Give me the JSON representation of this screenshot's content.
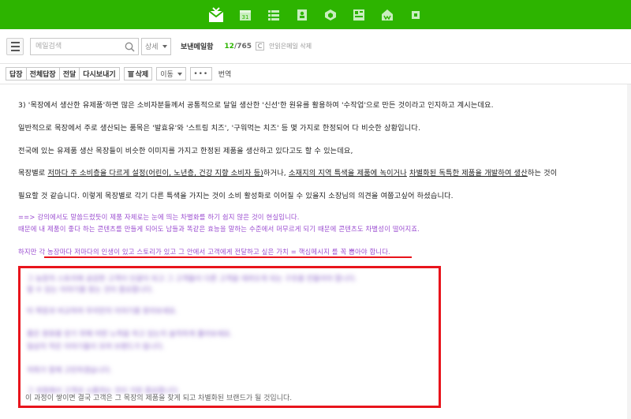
{
  "appbar": {
    "bg": "#2db400",
    "icons": [
      "mail-icon",
      "calendar-icon",
      "list-icon",
      "contacts-icon",
      "drive-icon",
      "memo-icon",
      "cafe-icon",
      "more-app-icon"
    ]
  },
  "search": {
    "placeholder": "메일검색",
    "detail_label": "상세"
  },
  "folder": {
    "title": "보낸메일함",
    "unread": "12",
    "total": "/765",
    "refresh": "C",
    "perm_delete": "안읽은메일 삭제"
  },
  "toolbar": {
    "reply": "답장",
    "reply_all": "전체답장",
    "forward": "전달",
    "resend": "다시보내기",
    "delete": "삭제",
    "move": "이동",
    "more": "•••",
    "translate": "번역"
  },
  "body": {
    "p1": "3) '목장에서 생산한 유제품'하면 많은 소비자분들께서 공통적으로 달일 생산한 '신선'한 원유를 활용하여 '수작업'으로 만든 것이라고 인지하고 계시는데요.",
    "p2": "일반적으로 목장에서 주로 생산되는 품목은 '발효유'와 '스트링 치즈', '구워먹는 치즈' 등 몇 가지로 한정되어 다 비슷한 상황입니다.",
    "p3": "전국에 있는 유제품 생산 목장들이 비슷한 이미지를 가지고 한정된 제품을 생산하고 있다고도 할 수 있는데요,",
    "p4a": "목장별로 ",
    "p4b": "저마다 주 소비층을 다르게 설정(어린이, 노년층, 건강 지향 소비자 등)",
    "p4c": "하거나, ",
    "p4d": "소재지의 지역 특색을 제품에 녹이거나",
    "p4e": " ",
    "p4f": "차별화된 독특한 제품을 개발하여 생산",
    "p4g": "하는 것이",
    "p5": "필요할 것 같습니다. 이렇게 목장별로 각기 다른 특색을 가지는 것이 소비 활성화로 이어질 수 있을지 소장님의 의견을 여쭙고싶어 하셨습니다.",
    "c1": "==> 강의에서도 말씀드렸듯이 제품 자체로는 눈에 띄는 차별화를 하기 쉽지 않은 것이 현실입니다.",
    "c2": "때문에 내 제품이 좋다 하는 콘텐츠를 만들게 되어도 남들과 똑같은 효능을 말하는 수준에서 머무르게 되기 때문에 콘텐츠도 차별성이 떨어지죠.",
    "c3": "하지만 각 농장마다 저마다의 인생이 있고 스토리가 있고 그 안에서 고객에게 전달하고 싶은 가치 = 핵심메시지 를 꼭 뽑아야 합니다.",
    "blur1": "그 농장의 스토리에 공감한 고객이 단골이 되고 그 고객들이 다른 고객을 데려오게 되는 구조를 만들어야 합니다.",
    "blur2": "할 수 있는 이야기를 찾는 것이 중요합니다.",
    "blur3": "타 목장과 비교하여 우리만의 이야기를 찾아보세요.",
    "blur4": "좋은 원유를 얻기 위해 어떤 노력을 하고 있는지 솔직하게 풀어보세요.",
    "blur5": "일상의 작은 이야기들이 모여 브랜드가 됩니다.",
    "blur6": "저희가 함께 고민하겠습니다.",
    "blur7": "그 과정에서 고객과 소통하는 것이 가장 중요합니다.",
    "last": "이 과정이 쌓이면 결국 고객은 그 목장의 제품을 찾게 되고 차별화된 브랜드가 될 것입니다."
  }
}
